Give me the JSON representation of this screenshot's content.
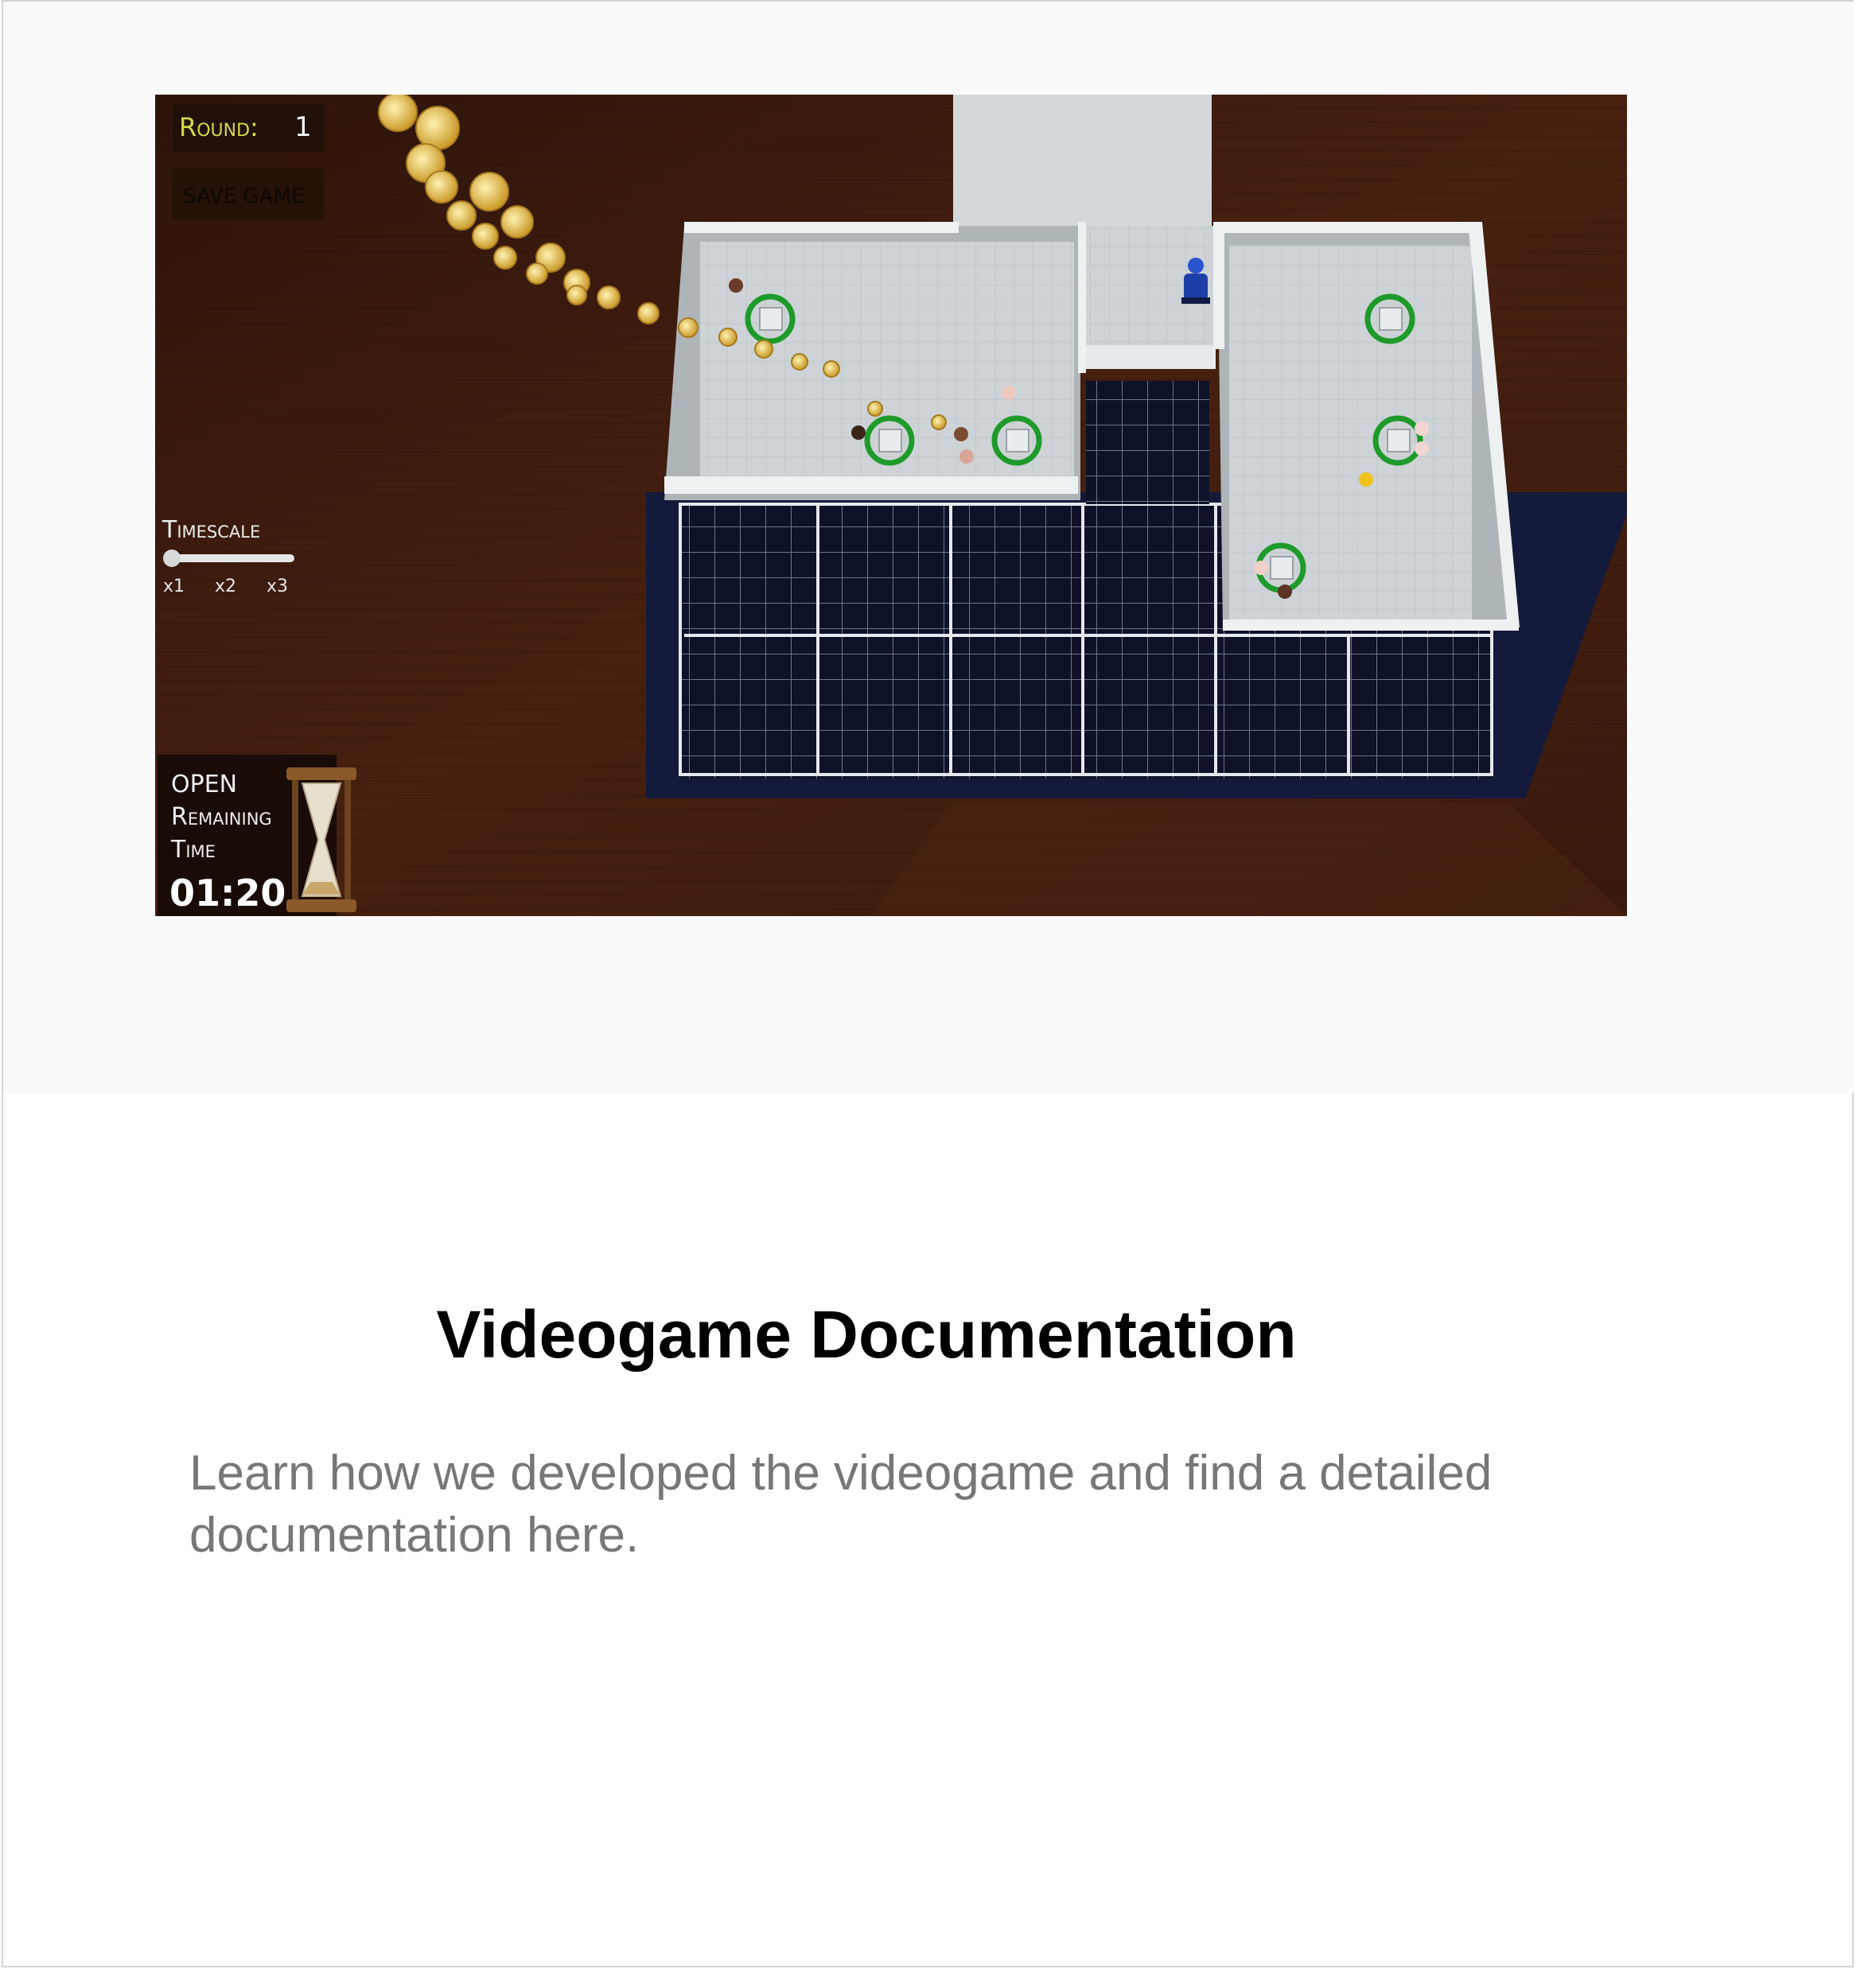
{
  "card": {
    "title": "Videogame Documentation",
    "description": "Learn how we developed the videogame and find a detailed documentation here."
  },
  "game_screenshot": {
    "round_label": "Round:",
    "round_value": "1",
    "save_button_label": "SAVE GAME",
    "timescale_label": "Timescale",
    "timescale_options": [
      "x1",
      "x2",
      "x3"
    ],
    "timescale_selected": "x1",
    "timer_label_lines": [
      "OPEN",
      "Remaining",
      "Time"
    ],
    "timer_value": "01:20",
    "icons": [
      "hourglass-icon",
      "coin-icon",
      "robot-icon",
      "table-icon",
      "customer-icon"
    ],
    "colors": {
      "board_background": "#3a1c10",
      "floor": "#c9d0d3",
      "tile_grid": "#0b1024",
      "table_ring": "#1e9a2a",
      "coin": "#e8c45a",
      "round_text": "#d8d84a"
    }
  }
}
